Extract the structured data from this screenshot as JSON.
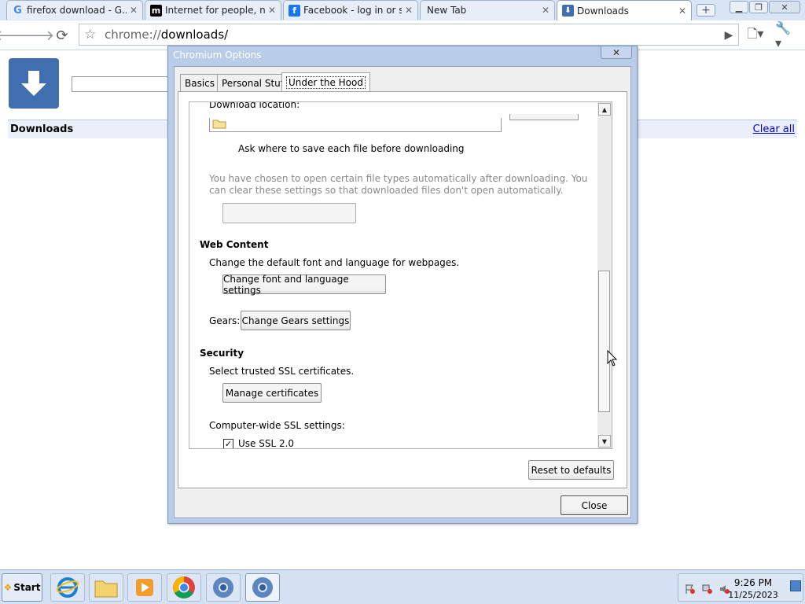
{
  "browser": {
    "tabs": [
      {
        "title": "firefox download - G...",
        "icon": "google-icon"
      },
      {
        "title": "Internet for people, n...",
        "icon": "mozilla-icon"
      },
      {
        "title": "Facebook - log in or s...",
        "icon": "facebook-icon"
      },
      {
        "title": "New Tab",
        "icon": ""
      },
      {
        "title": "Downloads",
        "icon": "downloads-icon"
      }
    ],
    "address": {
      "scheme": "chrome://",
      "host": "downloads/"
    }
  },
  "downloads_page": {
    "title": "Downloads",
    "clear_all": "Clear all"
  },
  "dialog": {
    "title": "Chromium Options",
    "tabs": [
      "Basics",
      "Personal Stuff",
      "Under the Hood"
    ],
    "download_location_label": "Download location:",
    "ask_label": "Ask where to save each file before downloading",
    "auto_open_note": "You have chosen to open certain file types automatically after downloading. You can clear these settings so that downloaded files don't open automatically.",
    "web_content_heading": "Web Content",
    "web_content_desc": "Change the default font and language for webpages.",
    "font_button": "Change font and language settings",
    "gears_label": "Gears:",
    "gears_button": "Change Gears settings",
    "security_heading": "Security",
    "security_desc": "Select trusted SSL certificates.",
    "certs_button": "Manage certificates",
    "ssl_settings_label": "Computer-wide SSL settings:",
    "ssl2_label": "Use SSL 2.0",
    "reset_button": "Reset to defaults",
    "close_button": "Close"
  },
  "taskbar": {
    "start_label": "Start",
    "time": "9:26 PM",
    "date": "11/25/2023"
  },
  "colors": {
    "dialog_frame": "#b9cde8",
    "link_blue": "#0000cc",
    "downloads_logo": "#3f6fae"
  }
}
